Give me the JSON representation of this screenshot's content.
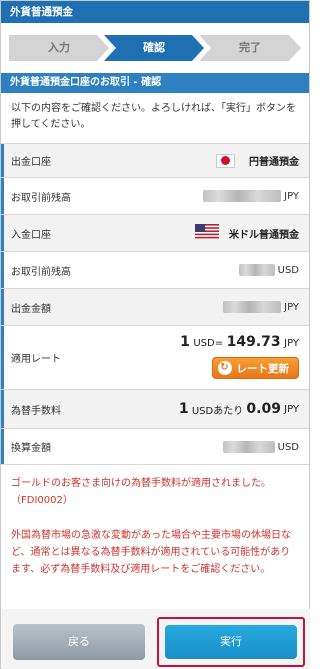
{
  "header": {
    "title": "外貨普通預金"
  },
  "steps": [
    {
      "label": "入力",
      "state": "done"
    },
    {
      "label": "確認",
      "state": "active"
    },
    {
      "label": "完了",
      "state": "todo"
    }
  ],
  "section": {
    "title": "外貨普通預金口座のお取引 - 確認",
    "intro": "以下の内容をご確認ください。よろしければ、「実行」ボタンを押してください。"
  },
  "rows": {
    "from_account": {
      "label": "出金口座",
      "value": "円普通預金",
      "icon": "japan-flag-icon"
    },
    "from_balance": {
      "label": "お取引前残高",
      "unit": "JPY"
    },
    "to_account": {
      "label": "入金口座",
      "value": "米ドル普通預金",
      "icon": "us-flag-icon"
    },
    "to_balance": {
      "label": "お取引前残高",
      "unit": "USD"
    },
    "withdraw_amount": {
      "label": "出金金額",
      "unit": "JPY"
    },
    "applied_rate": {
      "label": "適用レート",
      "base": "1",
      "base_unit": "USD=",
      "rate": "149.73",
      "rate_unit": "JPY",
      "refresh_label": "レート更新"
    },
    "fee": {
      "label": "為替手数料",
      "base": "1",
      "base_unit": "USDあたり",
      "amount": "0.09",
      "unit": "JPY"
    },
    "converted": {
      "label": "換算金額",
      "unit": "USD"
    }
  },
  "notices": {
    "gold": "ゴールドのお客さま向けの為替手数料が適用されました。（FDI0002）",
    "market": "外国為替市場の急激な変動があった場合や主要市場の休場日など、通常とは異なる為替手数料が適用されている可能性があります、必ず為替手数料及び適用レートをご確認ください。"
  },
  "buttons": {
    "back": "戻る",
    "execute": "実行"
  },
  "colors": {
    "header_blue": "#1f6fb3",
    "section_blue": "#2e80c0",
    "step_active": "#1f6fb3",
    "step_inactive": "#d4d4d4",
    "refresh_orange": "#e8761a",
    "notice_red": "#d0342c",
    "execute_blue": "#1a8fca",
    "highlight_red": "#c1163a"
  }
}
